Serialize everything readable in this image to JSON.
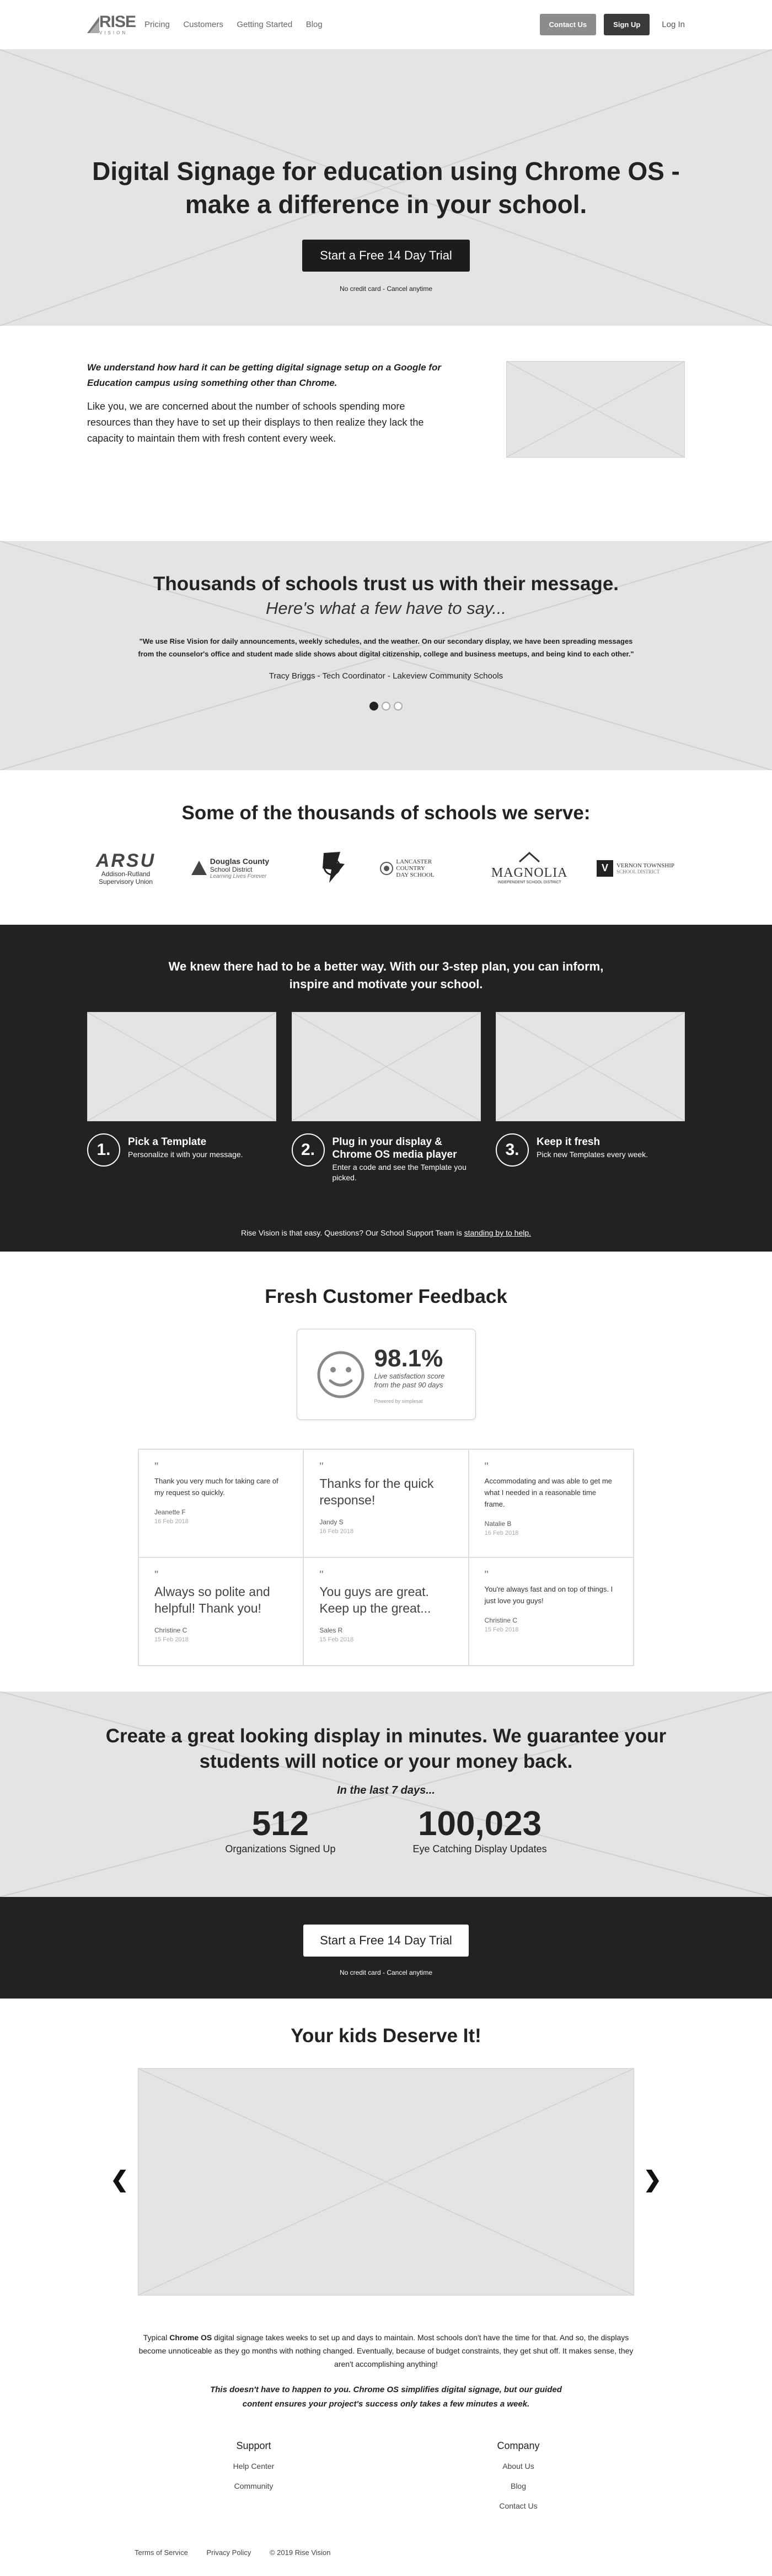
{
  "header": {
    "logo": "RISE",
    "logo_sub": "VISION",
    "nav": [
      "Pricing",
      "Customers",
      "Getting Started",
      "Blog"
    ],
    "contact": "Contact Us",
    "signup": "Sign Up",
    "login": "Log In"
  },
  "hero": {
    "title_1": "Digital Signage for education using Chrome OS -",
    "title_2": "make a difference in your school.",
    "cta": "Start a Free 14 Day Trial",
    "note": "No credit card - Cancel anytime"
  },
  "intro": {
    "bold": "We understand how hard it can be getting digital signage setup on a Google for Education campus using something other than Chrome.",
    "para": "Like you, we are concerned about the number of schools spending more resources than they have to set up their displays to then realize they lack the capacity to maintain them with fresh content every week."
  },
  "testimonial": {
    "title": "Thousands of schools trust us with their message.",
    "subtitle": "Here's what a few have to say...",
    "quote": "\"We use Rise Vision for daily announcements, weekly schedules, and the weather.  On our secondary display, we have been spreading messages from the counselor's office and student made slide shows about digital citizenship, college and business meetups, and being kind to each other.\"",
    "author": "Tracy Briggs - Tech Coordinator - Lakeview Community Schools"
  },
  "schools": {
    "title": "Some of the thousands of schools we serve:",
    "logos": [
      {
        "l1": "ARSU",
        "l2": "Addison-Rutland",
        "l3": "Supervisory Union"
      },
      {
        "l1": "Douglas County",
        "l2": "School District",
        "l3": "Learning Lives Forever"
      },
      {
        "l1": "",
        "l2": "",
        "l3": ""
      },
      {
        "l1": "LANCASTER COUNTRY",
        "l2": "DAY SCHOOL",
        "l3": ""
      },
      {
        "l1": "MAGNOLIA",
        "l2": "INDEPENDENT SCHOOL DISTRICT",
        "l3": ""
      },
      {
        "l1": "VERNON TOWNSHIP",
        "l2": "SCHOOL DISTRICT",
        "l3": ""
      }
    ]
  },
  "plan": {
    "title": "We knew there had to be a better way. With our 3-step plan, you can inform, inspire and motivate your school.",
    "steps": [
      {
        "num": "1.",
        "title": "Pick a Template",
        "desc": "Personalize it with your message."
      },
      {
        "num": "2.",
        "title": "Plug in your display & Chrome OS media player",
        "desc": "Enter a code and see the Template you picked."
      },
      {
        "num": "3.",
        "title": "Keep it fresh",
        "desc": "Pick new Templates every week."
      }
    ],
    "foot": "Rise Vision is that easy. Questions? Our School Support Team is",
    "foot_link": "standing by to help."
  },
  "feedback": {
    "title": "Fresh Customer Feedback",
    "score": "98.1%",
    "score_label_1": "Live satisfaction score",
    "score_label_2": "from the past 90 days",
    "powered": "Powered by simplesat",
    "reviews": [
      {
        "text": "Thank you very much for taking care of my request so quickly.",
        "name": "Jeanette F",
        "date": "16 Feb 2018",
        "size": "small"
      },
      {
        "text": "Thanks for the quick response!",
        "name": "Jandy S",
        "date": "16 Feb 2018",
        "size": "large"
      },
      {
        "text": "Accommodating and was able to get me what I needed in a reasonable time frame.",
        "name": "Natalie B",
        "date": "16 Feb 2018",
        "size": "small"
      },
      {
        "text": "Always so polite and helpful! Thank you!",
        "name": "Christine C",
        "date": "15 Feb 2018",
        "size": "large"
      },
      {
        "text": "You guys are great. Keep up the great...",
        "name": "Sales R",
        "date": "15 Feb 2018",
        "size": "large"
      },
      {
        "text": "You're always fast and on top of things. I just love you guys!",
        "name": "Christine C",
        "date": "15 Feb 2018",
        "size": "small"
      }
    ]
  },
  "guarantee": {
    "title": "Create a great looking display in minutes. We guarantee your students will notice or your money back.",
    "subtitle": "In the last 7 days...",
    "stat1_num": "512",
    "stat1_label": "Organizations Signed Up",
    "stat2_num": "100,023",
    "stat2_label": "Eye Catching Display Updates"
  },
  "cta2": {
    "button": "Start a Free 14 Day Trial",
    "note": "No credit card - Cancel anytime"
  },
  "kids": {
    "title": "Your kids Deserve It!",
    "p1_a": "Typical ",
    "p1_b": "Chrome OS",
    "p1_c": " digital signage takes weeks to set up and days to maintain. Most schools don't have the time for that. And so, the displays become unnoticeable as they go months with nothing changed. Eventually, because of budget constraints, they get shut off. It makes sense, they aren't accomplishing anything!",
    "p2": "This doesn't have to happen to you. Chrome OS simplifies digital signage, but our guided content ensures your project's success only takes a few minutes a week.",
    "prev": "❮",
    "next": "❯"
  },
  "footer": {
    "support_title": "Support",
    "support_items": [
      "Help Center",
      "Community"
    ],
    "company_title": "Company",
    "company_items": [
      "About Us",
      "Blog",
      "Contact Us"
    ],
    "terms": "Terms of Service",
    "privacy": "Privacy Policy",
    "copyright": "© 2019 Rise Vision"
  }
}
